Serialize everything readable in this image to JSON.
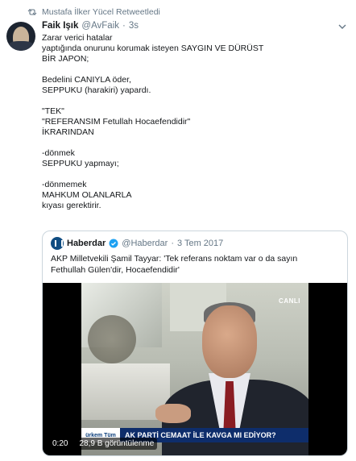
{
  "retweet": {
    "icon": "retweet-icon",
    "text": "Mustafa İlker Yücel Retweetledi"
  },
  "tweet": {
    "author_name": "Faik Işık",
    "author_handle": "@AvFaik",
    "dot": "·",
    "time": "3s",
    "lines": [
      "Zarar verici hatalar",
      "yaptığında onurunu korumak isteyen SAYGIN VE DÜRÜST",
      "BİR JAPON;",
      "",
      "Bedelini CANIYLA öder,",
      "SEPPUKU (harakiri) yapardı.",
      "",
      "\"TEK\"",
      "\"REFERANSIM Fetullah Hocaefendidir\"",
      "İKRARINDAN",
      "",
      "-dönmek",
      "SEPPUKU yapmayı;",
      "",
      "-dönmemek",
      "MAHKUM OLANLARLA",
      "kıyası gerektirir."
    ]
  },
  "quote": {
    "name": "Haberdar",
    "handle": "@Haberdar",
    "dot": "·",
    "date": "3 Tem 2017",
    "lines": [
      "AKP Milletvekili Şamil Tayyar: 'Tek referans noktam var o da sayın",
      "Fethullah Gülen'dir, Hocaefendidir'"
    ],
    "video": {
      "channel_logo": "CANLI",
      "ticker_tag": "ürkem Tüm",
      "ticker_text": "AK PARTİ CEMAAT İLE KAVGA MI EDİYOR?",
      "time": "0:20",
      "views": "28,9 B görüntülenme"
    }
  },
  "colors": {
    "secondary_text": "#657786",
    "border": "#ccd6dd",
    "verified_blue": "#1da1f2"
  }
}
